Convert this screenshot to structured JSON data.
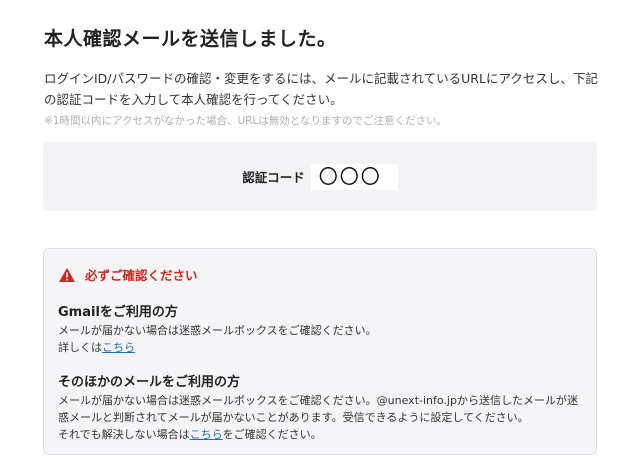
{
  "page": {
    "title": "本人確認メールを送信しました。",
    "description": "ログインID/パスワードの確認・変更をするには、メールに記載されているURLにアクセスし、下記の認証コードを入力して本人確認を行ってください。",
    "note": "※1時間以内にアクセスがなかった場合、URLは無効となりますのでご注意ください。"
  },
  "code": {
    "label": "認証コード",
    "value": "〇〇〇"
  },
  "notice": {
    "heading": "必ずご確認ください",
    "icon": "warning-icon",
    "accent_color": "#d0281e",
    "gmail": {
      "title": "Gmailをご利用の方",
      "text": "メールが届かない場合は迷惑メールボックスをご確認ください。",
      "detail_prefix": "詳しくは",
      "link": "こちら"
    },
    "other": {
      "title": "そのほかのメールをご利用の方",
      "text": "メールが届かない場合は迷惑メールボックスをご確認ください。@unext-info.jpから送信したメールが迷惑メールと判断されてメールが届かないことがあります。受信できるように設定してください。",
      "fallback_prefix": "それでも解決しない場合は",
      "link": "こちら",
      "fallback_suffix": "をご確認ください。"
    }
  },
  "colors": {
    "link": "#1a6fb0",
    "box_background": "#f3f3f5"
  }
}
